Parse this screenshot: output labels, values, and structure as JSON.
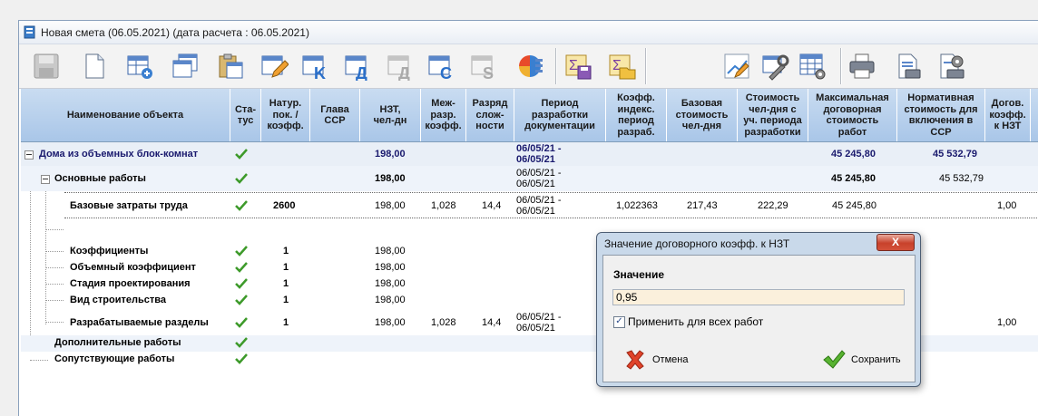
{
  "window": {
    "title": "Новая смета (06.05.2021) (дата расчета : 06.05.2021)"
  },
  "toolbar": {
    "buttons": [
      "save-icon",
      "new-document-icon",
      "add-table-icon",
      "copy-window-icon",
      "paste-icon",
      "edit-table-icon",
      "table-k-icon",
      "table-d-icon",
      "table-e-icon",
      "table-c-icon",
      "table-s-icon",
      "cube-icon",
      "sum-save-icon",
      "sum-folder-icon",
      "chart-edit-icon",
      "tools-icon",
      "grid-settings-icon",
      "print-icon",
      "print-preview-icon",
      "print-settings-icon"
    ]
  },
  "grid": {
    "columns": [
      "Наименование объекта",
      "Ста-тус",
      "Натур. пок. / коэфф.",
      "Глава ССР",
      "НЗТ, чел-дн",
      "Меж-разр. коэфф.",
      "Разряд слож-ности",
      "Период разработки документации",
      "Коэфф. индекс. период разраб.",
      "Базовая стоимость чел-дня",
      "Стоимость чел-дня с уч. периода разработки",
      "Максимальная договорная стоимость работ",
      "Нормативная стоимость для включения в ССР",
      "Догов. коэфф. к НЗТ"
    ],
    "rows": [
      {
        "name": "Дома из объемных блок-комнат",
        "nat": "",
        "nzt": "198,00",
        "mezh": "",
        "razr": "",
        "period": "06/05/21 - 06/05/21",
        "kind": "",
        "base": "",
        "cost": "",
        "max": "45 245,80",
        "norm": "45 532,79",
        "dog": ""
      },
      {
        "name": "Основные работы",
        "nat": "",
        "nzt": "198,00",
        "mezh": "",
        "razr": "",
        "period": "06/05/21 - 06/05/21",
        "kind": "",
        "base": "",
        "cost": "",
        "max": "45 245,80",
        "norm": "45 532,79",
        "dog": ""
      },
      {
        "name": "Базовые затраты труда",
        "nat": "2600",
        "nzt": "198,00",
        "mezh": "1,028",
        "razr": "14,4",
        "period": "06/05/21 - 06/05/21",
        "kind": "1,022363",
        "base": "217,43",
        "cost": "222,29",
        "max": "45 245,80",
        "norm": "",
        "dog": "1,00"
      },
      {
        "name": "Коэффициенты",
        "nat": "1",
        "nzt": "198,00"
      },
      {
        "name": "Объемный коэффициент",
        "nat": "1",
        "nzt": "198,00"
      },
      {
        "name": "Стадия проектирования",
        "nat": "1",
        "nzt": "198,00"
      },
      {
        "name": "Вид строительства",
        "nat": "1",
        "nzt": "198,00"
      },
      {
        "name": "Разрабатываемые разделы",
        "nat": "1",
        "nzt": "198,00",
        "mezh": "1,028",
        "razr": "14,4",
        "period": "06/05/21 - 06/05/21",
        "dog": "1,00"
      },
      {
        "name": "Дополнительные работы"
      },
      {
        "name": "Сопутствующие работы"
      }
    ]
  },
  "dialog": {
    "title": "Значение договорного коэфф. к НЗТ",
    "close_label": "X",
    "field_label": "Значение",
    "value": "0,95",
    "apply_all_label": "Применить для всех работ",
    "apply_all_checked": true,
    "cancel_label": "Отмена",
    "save_label": "Сохранить"
  },
  "colors": {
    "header": "#b7d0ec",
    "group_row": "#eef3fa",
    "check": "#3d9a2a"
  }
}
